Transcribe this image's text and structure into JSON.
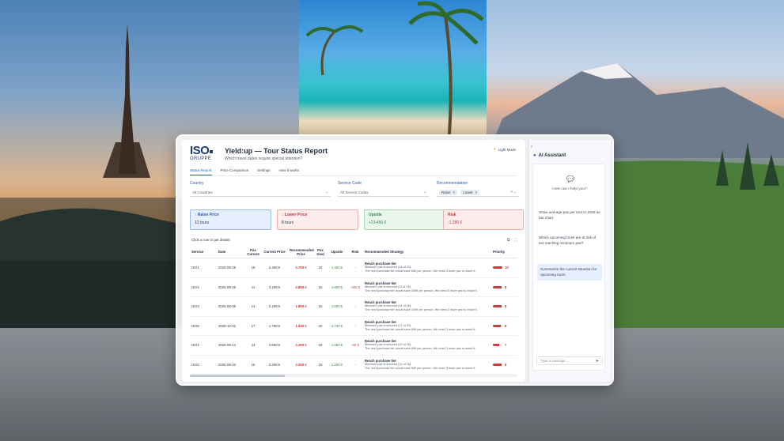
{
  "app": {
    "logo_main": "ISO",
    "logo_sub": "GRUPPE",
    "title": "Yield:up — Tour Status Report",
    "subtitle": "Which travel dates require special attention?",
    "mode_toggle": "Light Mode"
  },
  "tabs": [
    {
      "label": "Status Report",
      "active": true
    },
    {
      "label": "Price Comparison",
      "active": false
    },
    {
      "label": "Settings",
      "active": false
    },
    {
      "label": "How it works",
      "active": false
    }
  ],
  "filters": {
    "country": {
      "label": "Country",
      "value": "All Countries"
    },
    "service_code": {
      "label": "Service Code",
      "value": "All Service Codes"
    },
    "recommendation": {
      "label": "Recommendation",
      "chips": [
        "Raise",
        "Lower"
      ]
    }
  },
  "cards": {
    "raise": {
      "title": "Raise Price",
      "value": "12 tours"
    },
    "lower": {
      "title": "Lower Price",
      "value": "8 tours"
    },
    "upside": {
      "title": "Upside",
      "value": "+23.450 €"
    },
    "risk": {
      "title": "Risk",
      "value": "-1.280 €"
    }
  },
  "table": {
    "hint": "Click a row to get details",
    "headers": [
      "Service",
      "Date",
      "Pax Current",
      "Current Price",
      "Recommended Price",
      "Pax Goal",
      "Upside",
      "Risk",
      "Recommended Strategy",
      "Priority"
    ],
    "rows": [
      {
        "service": "ISO1",
        "date": "2025-09-28",
        "pax": "18",
        "current": "2.499 €",
        "recommended": "2.799 €",
        "goal": "22",
        "upside": "1.400 €",
        "risk": "-",
        "strategy_title": "Reach purchase tier",
        "strategy_line1": "Minimum pax is secured (18 of 20).",
        "strategy_line2": "The next purchase tier would save 50€ per person. We need 4 more pax to reach it.",
        "priority": 10
      },
      {
        "service": "ISO4",
        "date": "2025-09-26",
        "pax": "11",
        "current": "3.199 €",
        "recommended": "2.899 €",
        "goal": "16",
        "upside": "4.800 €",
        "risk": "-300 €",
        "strategy_title": "Reach purchase tier",
        "strategy_line1": "Minimum pax is secured (11 of 16).",
        "strategy_line2": "The next purchase tier would save 300€ per person. We need 5 more pax to reach it.",
        "priority": 9
      },
      {
        "service": "ISO3",
        "date": "2025-09-05",
        "pax": "14",
        "current": "2.199 €",
        "recommended": "1.899 €",
        "goal": "16",
        "upside": "1.600 €",
        "risk": "-",
        "strategy_title": "Reach purchase tier",
        "strategy_line1": "Minimum pax is secured (14 of 16).",
        "strategy_line2": "The next purchase tier would save 100€ per person. We need 2 more pax to reach it.",
        "priority": 9
      },
      {
        "service": "ISO5",
        "date": "2025-10-02",
        "pax": "17",
        "current": "1.799 €",
        "recommended": "1.049 €",
        "goal": "20",
        "upside": "1.740 €",
        "risk": "-",
        "strategy_title": "Reach purchase tier",
        "strategy_line1": "Minimum pax is secured (17 of 20).",
        "strategy_line2": "The next purchase tier would save 60€ per person. We need 3 more pax to reach it.",
        "priority": 8
      },
      {
        "service": "ISO1",
        "date": "2025-09-14",
        "pax": "23",
        "current": "2.699 €",
        "recommended": "2.299 €",
        "goal": "26",
        "upside": "1.560 €",
        "risk": "-60 €",
        "strategy_title": "Reach purchase tier",
        "strategy_line1": "Minimum pax is secured (23 of 26).",
        "strategy_line2": "The next purchase tier would save 60€ per person. We need 3 more pax to reach it.",
        "priority": 7
      },
      {
        "service": "ISO2",
        "date": "2025-09-20",
        "pax": "15",
        "current": "2.299 €",
        "recommended": "2.099 €",
        "goal": "18",
        "upside": "1.200 €",
        "risk": "-",
        "strategy_title": "Reach purchase tier",
        "strategy_line1": "Minimum pax is secured (15 of 18).",
        "strategy_line2": "The next purchase tier would save 50€ per person. We need 3 more pax to reach it.",
        "priority": 9
      }
    ]
  },
  "assistant": {
    "title": "AI Assistant",
    "help": "How can I help you?",
    "suggestions": [
      "Show average pax per tour in 2025 as bar chart.",
      "Which upcoming tours are at risk of not reaching minimum pax?",
      "Summarize the current situation for upcoming tours."
    ],
    "input_placeholder": "Type a message..."
  },
  "colors": {
    "accent": "#2b5fa8",
    "danger": "#d23b3b",
    "success": "#2f8a45"
  }
}
